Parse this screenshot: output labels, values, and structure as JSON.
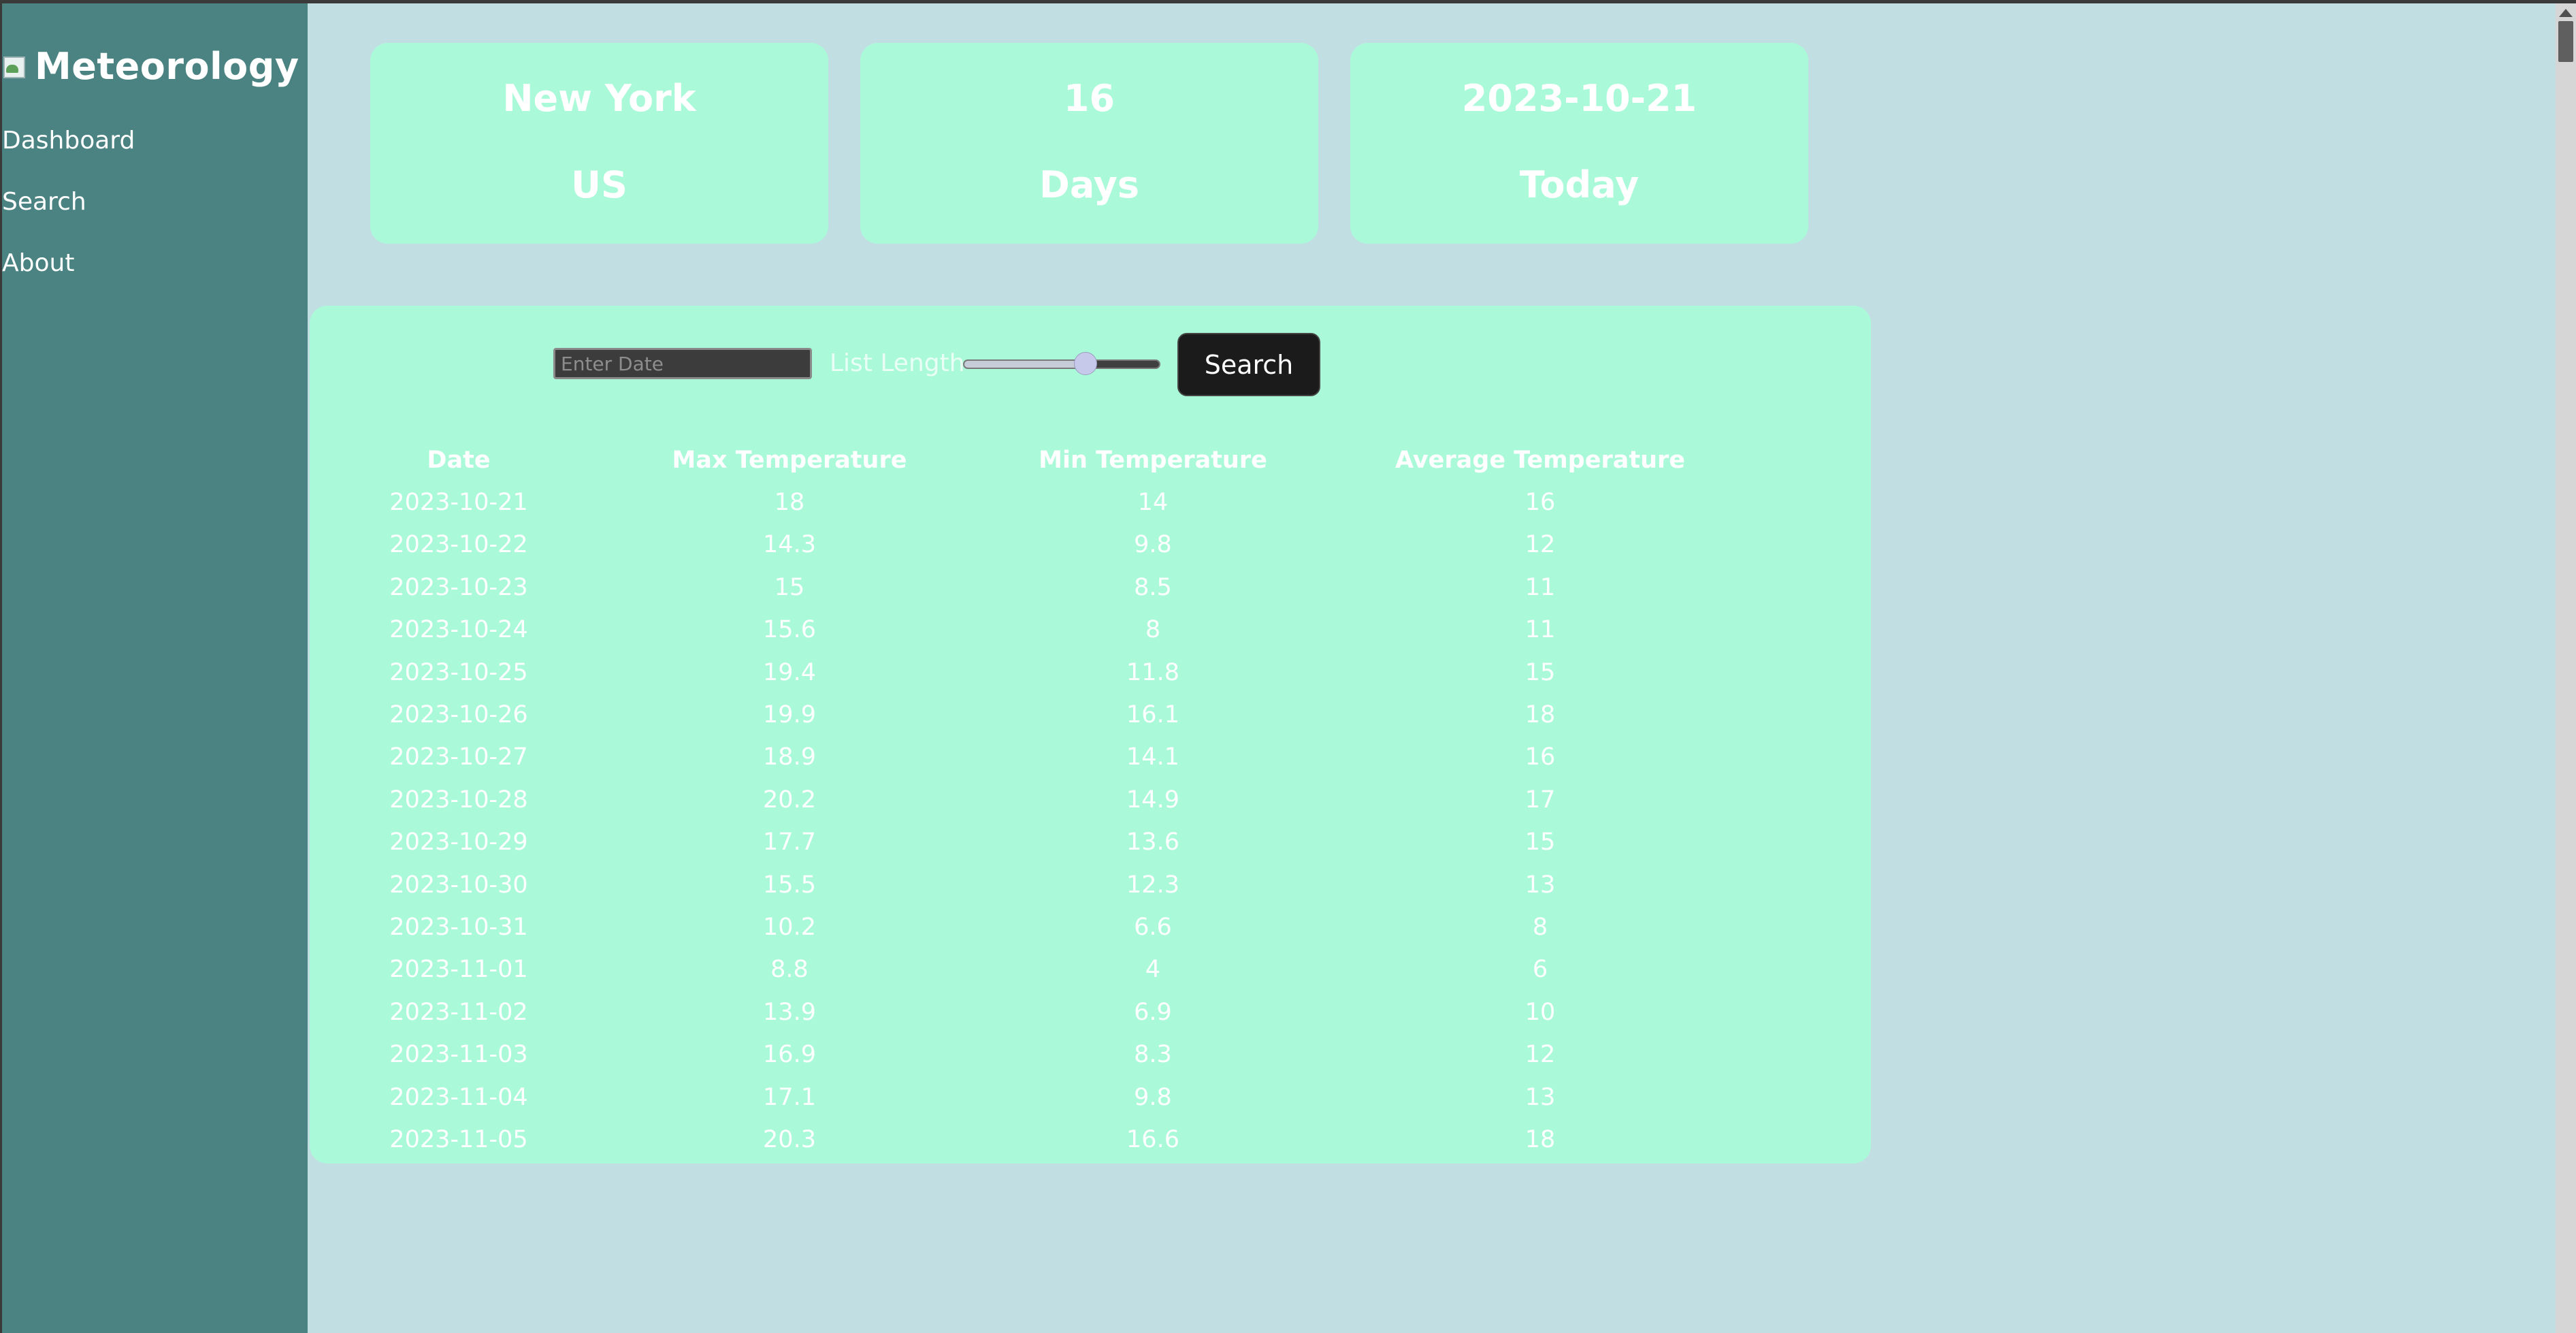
{
  "sidebar": {
    "brand_title": "Meteorology",
    "nav": [
      "Dashboard",
      "Search",
      "About"
    ]
  },
  "cards": [
    {
      "line1": "New York",
      "line2": "US"
    },
    {
      "line1": "16",
      "line2": "Days"
    },
    {
      "line1": "2023-10-21",
      "line2": "Today"
    }
  ],
  "controls": {
    "date_placeholder": "Enter Date",
    "date_value": "",
    "list_length_label": "List Length",
    "list_length_fraction": 0.62,
    "search_label": "Search"
  },
  "table": {
    "headers": [
      "Date",
      "Max Temperature",
      "Min Temperature",
      "Average Temperature"
    ],
    "rows": [
      [
        "2023-10-21",
        "18",
        "14",
        "16"
      ],
      [
        "2023-10-22",
        "14.3",
        "9.8",
        "12"
      ],
      [
        "2023-10-23",
        "15",
        "8.5",
        "11"
      ],
      [
        "2023-10-24",
        "15.6",
        "8",
        "11"
      ],
      [
        "2023-10-25",
        "19.4",
        "11.8",
        "15"
      ],
      [
        "2023-10-26",
        "19.9",
        "16.1",
        "18"
      ],
      [
        "2023-10-27",
        "18.9",
        "14.1",
        "16"
      ],
      [
        "2023-10-28",
        "20.2",
        "14.9",
        "17"
      ],
      [
        "2023-10-29",
        "17.7",
        "13.6",
        "15"
      ],
      [
        "2023-10-30",
        "15.5",
        "12.3",
        "13"
      ],
      [
        "2023-10-31",
        "10.2",
        "6.6",
        "8"
      ],
      [
        "2023-11-01",
        "8.8",
        "4",
        "6"
      ],
      [
        "2023-11-02",
        "13.9",
        "6.9",
        "10"
      ],
      [
        "2023-11-03",
        "16.9",
        "8.3",
        "12"
      ],
      [
        "2023-11-04",
        "17.1",
        "9.8",
        "13"
      ],
      [
        "2023-11-05",
        "20.3",
        "16.6",
        "18"
      ]
    ]
  },
  "colors": {
    "background": "#c1dfe3",
    "sidebar": "#4a8382",
    "panel": "#aafad9",
    "button": "#1b1b1b"
  },
  "icons": {
    "brand": "broken-image-icon"
  }
}
